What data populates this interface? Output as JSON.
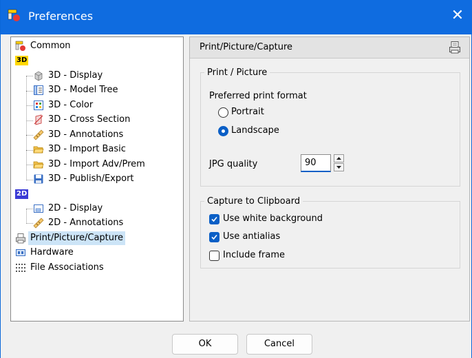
{
  "window": {
    "title": "Preferences"
  },
  "tree": {
    "items": [
      {
        "label": "Common",
        "icon": "common-settings-icon"
      },
      {
        "label": "3D",
        "icon": "3d-badge"
      },
      {
        "label": "3D - Display",
        "icon": "cube-icon"
      },
      {
        "label": "3D - Model Tree",
        "icon": "model-tree-icon"
      },
      {
        "label": "3D - Color",
        "icon": "color-palette-icon"
      },
      {
        "label": "3D - Cross Section",
        "icon": "cross-section-icon"
      },
      {
        "label": "3D - Annotations",
        "icon": "ruler-icon"
      },
      {
        "label": "3D - Import Basic",
        "icon": "folder-open-icon"
      },
      {
        "label": "3D - Import Adv/Prem",
        "icon": "folder-open-icon"
      },
      {
        "label": "3D - Publish/Export",
        "icon": "floppy-disk-icon"
      },
      {
        "label": "2D",
        "icon": "2d-badge"
      },
      {
        "label": "2D - Display",
        "icon": "2d-display-icon"
      },
      {
        "label": "2D - Annotations",
        "icon": "ruler-icon"
      },
      {
        "label": "Print/Picture/Capture",
        "icon": "printer-icon"
      },
      {
        "label": "Hardware",
        "icon": "hardware-icon"
      },
      {
        "label": "File Associations",
        "icon": "file-associations-icon"
      }
    ]
  },
  "panel": {
    "title": "Print/Picture/Capture",
    "print_group": {
      "title": "Print / Picture",
      "format_label": "Preferred print format",
      "portrait_label": "Portrait",
      "landscape_label": "Landscape",
      "selected": "Landscape",
      "jpg_label": "JPG quality",
      "jpg_value": "90"
    },
    "capture_group": {
      "title": "Capture to Clipboard",
      "white_bg_label": "Use white background",
      "white_bg_checked": true,
      "antialias_label": "Use antialias",
      "antialias_checked": true,
      "frame_label": "Include frame",
      "frame_checked": false
    }
  },
  "buttons": {
    "ok": "OK",
    "cancel": "Cancel"
  },
  "colors": {
    "titlebar": "#0f6ce0",
    "accent": "#0a5fc6",
    "selection": "#cce4f7"
  }
}
